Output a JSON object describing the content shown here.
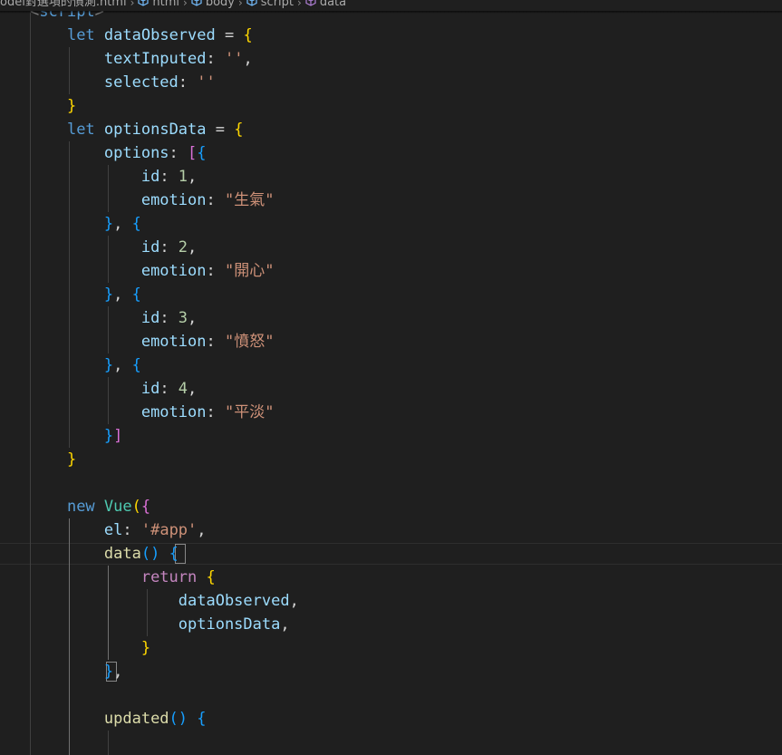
{
  "breadcrumb": {
    "file": "odel對選項的偵測.html",
    "items": [
      "html",
      "body",
      "script",
      "data"
    ]
  },
  "colors": {
    "background": "#1f1f1f",
    "keyword": "#569cd6",
    "control": "#c586c0",
    "variable": "#9cdcfe",
    "function": "#dcdcaa",
    "class": "#4ec9b0",
    "string": "#ce9178",
    "number": "#b5cea8",
    "bracket_level1": "#ffd700",
    "bracket_level2": "#da70d6",
    "bracket_level3": "#179fff"
  },
  "code": {
    "script_tag": "script",
    "let_kw": "let",
    "new_kw": "new",
    "return_kw": "return",
    "data_observed": "dataObserved",
    "text_inputed": "textInputed",
    "selected": "selected",
    "empty_str": "''",
    "options_data": "optionsData",
    "options": "options",
    "id_key": "id",
    "emotion_key": "emotion",
    "opt1_id": "1",
    "opt1_emotion": "\"生氣\"",
    "opt2_id": "2",
    "opt2_emotion": "\"開心\"",
    "opt3_id": "3",
    "opt3_emotion": "\"憤怒\"",
    "opt4_id": "4",
    "opt4_emotion": "\"平淡\"",
    "vue": "Vue",
    "el_key": "el",
    "el_value": "'#app'",
    "data_fn": "data",
    "updated_fn": "updated"
  }
}
